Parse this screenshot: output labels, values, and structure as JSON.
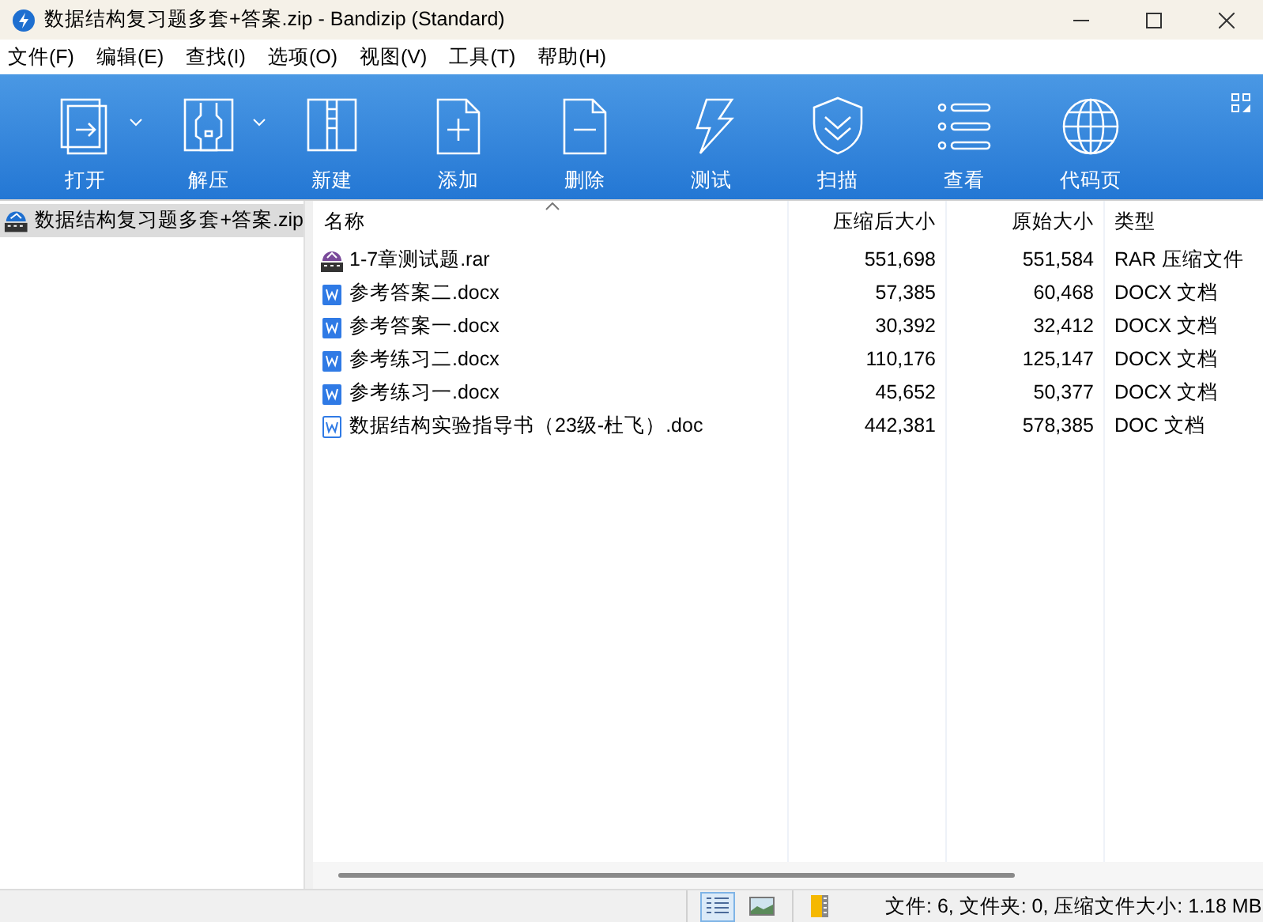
{
  "window": {
    "title": "数据结构复习题多套+答案.zip - Bandizip (Standard)"
  },
  "menu": [
    "文件(F)",
    "编辑(E)",
    "查找(I)",
    "选项(O)",
    "视图(V)",
    "工具(T)",
    "帮助(H)"
  ],
  "toolbar": [
    {
      "kind": "open",
      "label": "打开",
      "dropdown": true
    },
    {
      "kind": "extract",
      "label": "解压",
      "dropdown": true
    },
    {
      "kind": "new",
      "label": "新建",
      "dropdown": false
    },
    {
      "kind": "add",
      "label": "添加",
      "dropdown": false
    },
    {
      "kind": "delete",
      "label": "删除",
      "dropdown": false
    },
    {
      "kind": "test",
      "label": "测试",
      "dropdown": false
    },
    {
      "kind": "scan",
      "label": "扫描",
      "dropdown": false
    },
    {
      "kind": "view",
      "label": "查看",
      "dropdown": false
    },
    {
      "kind": "codepage",
      "label": "代码页",
      "dropdown": false
    }
  ],
  "tree": [
    {
      "label": "数据结构复习题多套+答案.zip",
      "selected": true
    }
  ],
  "table": {
    "columns": [
      "名称",
      "压缩后大小",
      "原始大小",
      "类型"
    ],
    "rows": [
      {
        "kind": "rar",
        "name": "1-7章测试题.rar",
        "packed": "551,698",
        "size": "551,584",
        "type": "RAR 压缩文件"
      },
      {
        "kind": "docx",
        "name": "参考答案二.docx",
        "packed": "57,385",
        "size": "60,468",
        "type": "DOCX 文档"
      },
      {
        "kind": "docx",
        "name": "参考答案一.docx",
        "packed": "30,392",
        "size": "32,412",
        "type": "DOCX 文档"
      },
      {
        "kind": "docx",
        "name": "参考练习二.docx",
        "packed": "110,176",
        "size": "125,147",
        "type": "DOCX 文档"
      },
      {
        "kind": "docx",
        "name": "参考练习一.docx",
        "packed": "45,652",
        "size": "50,377",
        "type": "DOCX 文档"
      },
      {
        "kind": "doc",
        "name": "数据结构实验指导书（23级-杜飞）.doc",
        "packed": "442,381",
        "size": "578,385",
        "type": "DOC 文档"
      }
    ]
  },
  "view_buttons": [
    {
      "kind": "details",
      "selected": true
    },
    {
      "kind": "thumbnails",
      "selected": false
    }
  ],
  "status_bar": "文件: 6, 文件夹: 0, 压缩文件大小: 1.18 MB"
}
